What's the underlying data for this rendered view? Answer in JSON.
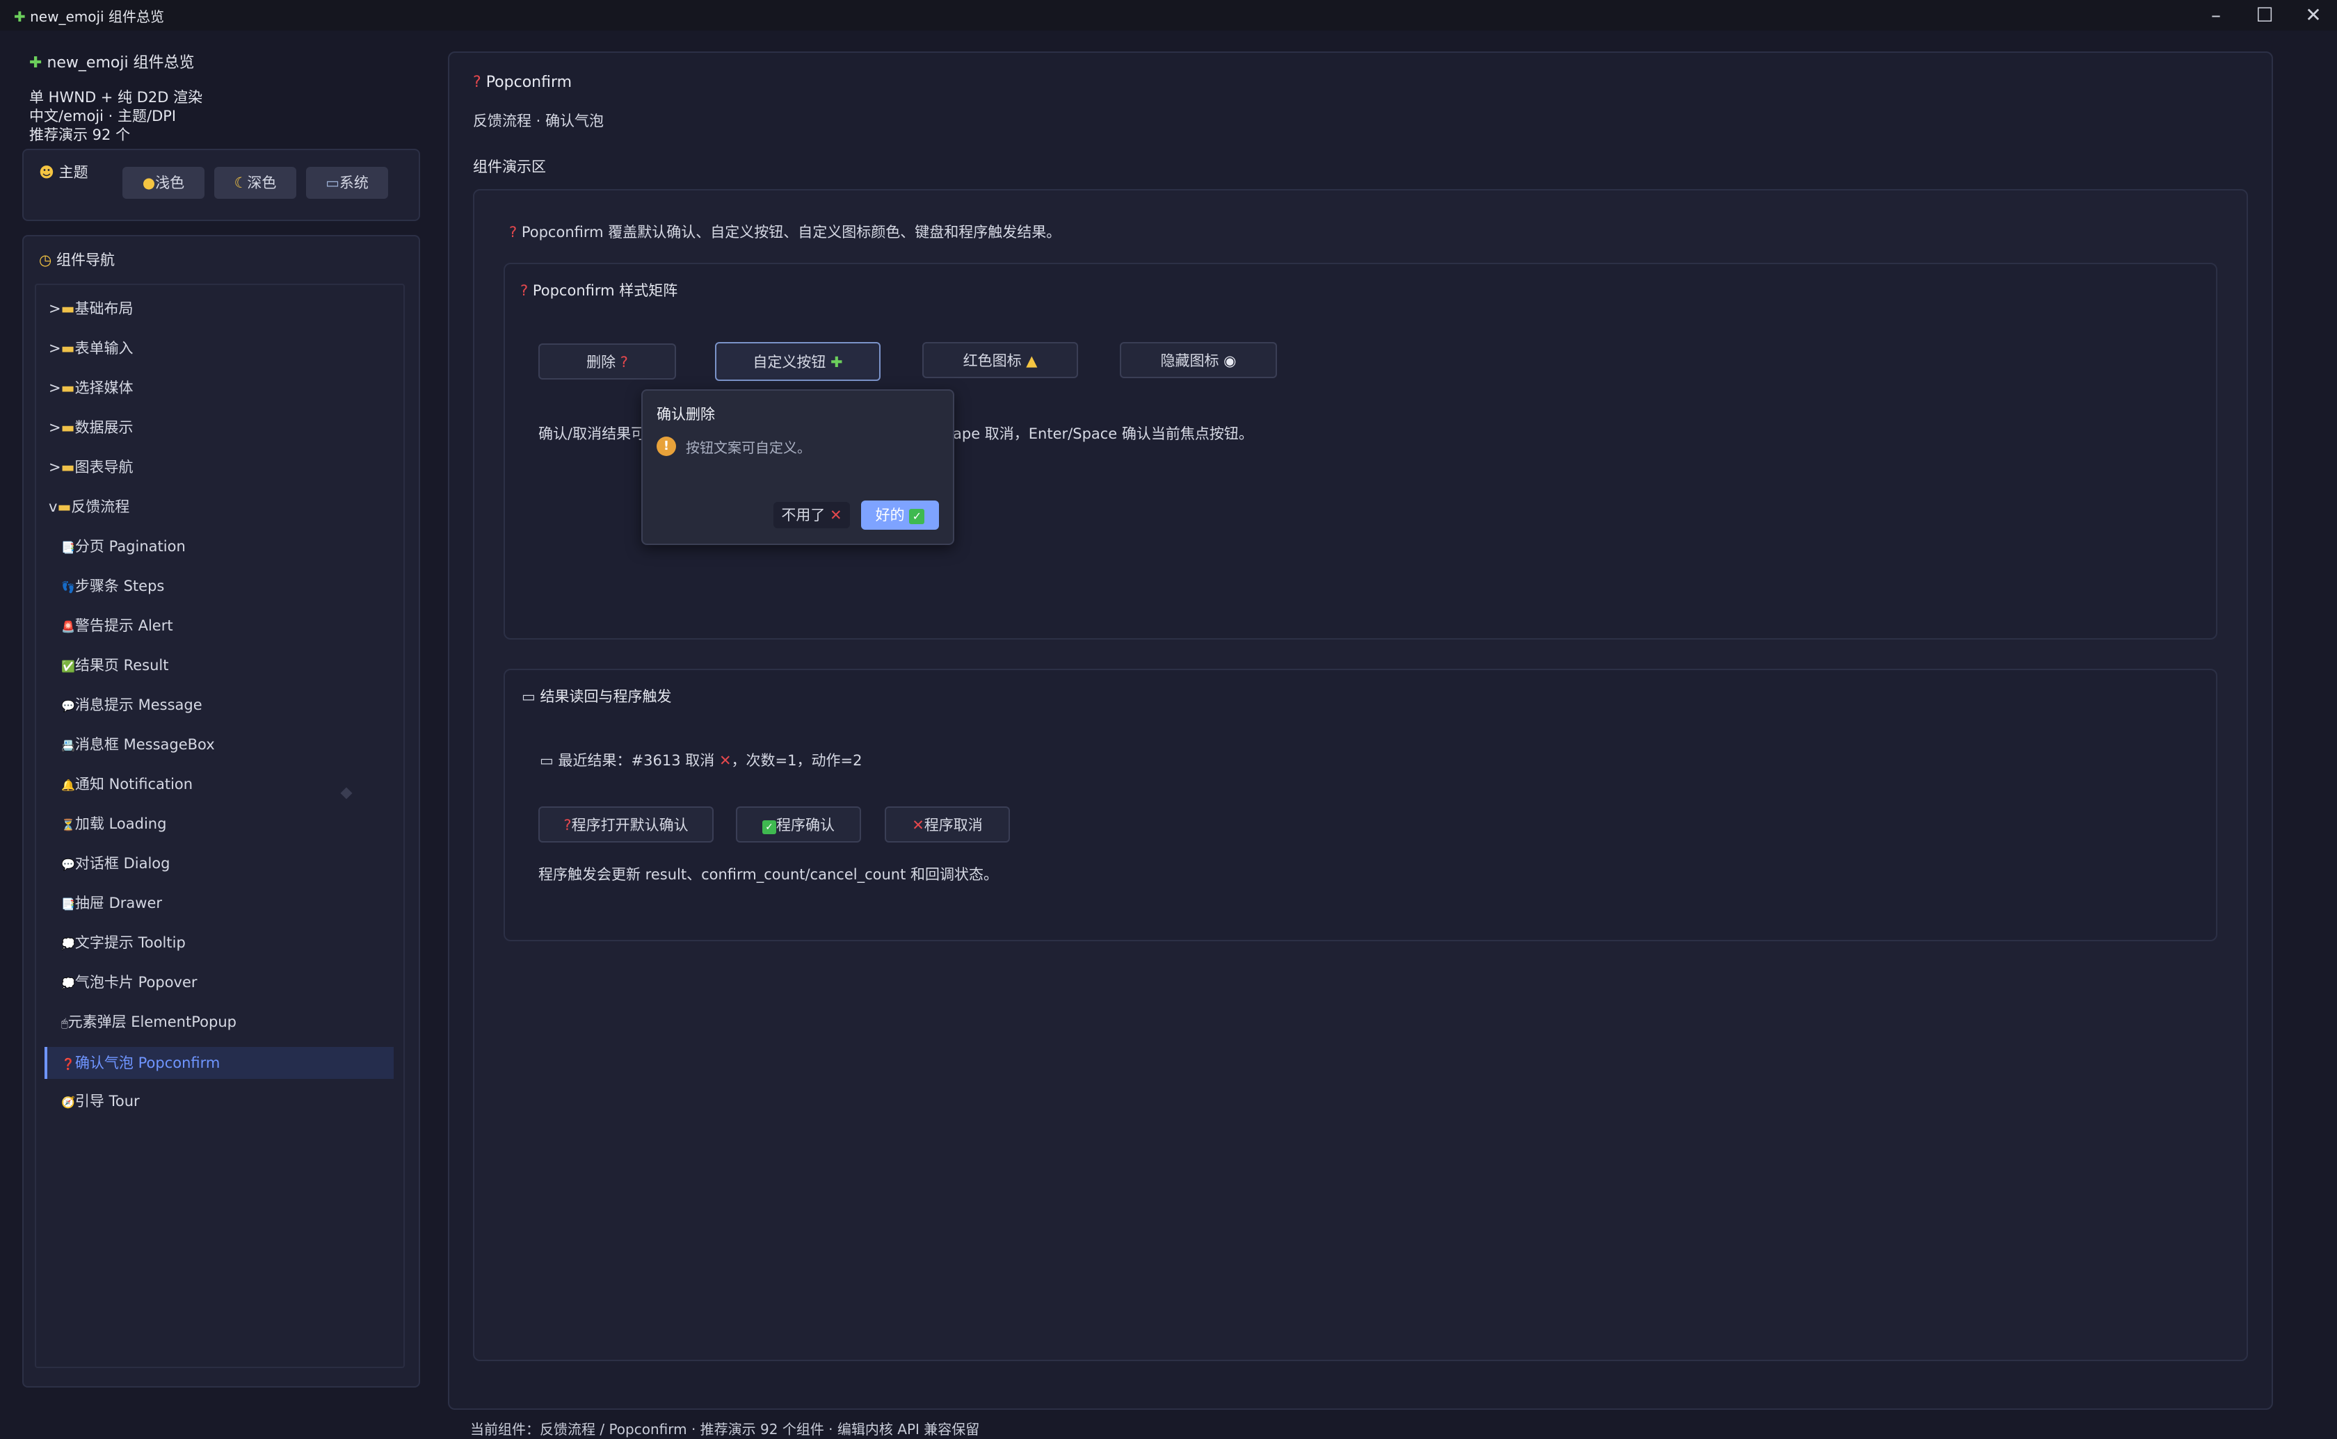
{
  "window": {
    "title": "new_emoji 组件总览",
    "title_icon": "puzzle-icon",
    "controls": [
      "minimize",
      "maximize",
      "close"
    ]
  },
  "sidebar": {
    "app_title": "new_emoji 组件总览",
    "info_lines": [
      "单 HWND + 纯 D2D 渲染",
      "中文/emoji · 主题/DPI",
      "推荐演示 92 个"
    ],
    "theme": {
      "label": "主题",
      "buttons": [
        {
          "label": "浅色",
          "icon": "sun-icon"
        },
        {
          "label": "深色",
          "icon": "moon-icon"
        },
        {
          "label": "系统",
          "icon": "laptop-icon"
        }
      ]
    },
    "nav": {
      "label": "组件导航",
      "groups": [
        {
          "label": "基础布局",
          "expanded": false
        },
        {
          "label": "表单输入",
          "expanded": false
        },
        {
          "label": "选择媒体",
          "expanded": false
        },
        {
          "label": "数据展示",
          "expanded": false
        },
        {
          "label": "图表导航",
          "expanded": false
        },
        {
          "label": "反馈流程",
          "expanded": true
        }
      ],
      "collapsed_marker": ">",
      "expanded_marker": "v",
      "items": [
        {
          "icon": "📑",
          "label": "分页 Pagination"
        },
        {
          "icon": "👣",
          "label": "步骤条 Steps"
        },
        {
          "icon": "🚨",
          "label": "警告提示 Alert"
        },
        {
          "icon": "✅",
          "label": "结果页 Result"
        },
        {
          "icon": "💬",
          "label": "消息提示 Message"
        },
        {
          "icon": "📇",
          "label": "消息框 MessageBox"
        },
        {
          "icon": "🔔",
          "label": "通知 Notification"
        },
        {
          "icon": "⏳",
          "label": "加载 Loading"
        },
        {
          "icon": "💬",
          "label": "对话框 Dialog"
        },
        {
          "icon": "📑",
          "label": "抽屉 Drawer"
        },
        {
          "icon": "💭",
          "label": "文字提示 Tooltip"
        },
        {
          "icon": "💭",
          "label": "气泡卡片 Popover"
        },
        {
          "icon": "🖱",
          "label": "元素弹层 ElementPopup"
        },
        {
          "icon": "❓",
          "label": "确认气泡 Popconfirm",
          "selected": true
        },
        {
          "icon": "🧭",
          "label": "引导 Tour"
        }
      ]
    }
  },
  "main": {
    "title": "Popconfirm",
    "subtitle": "反馈流程 · 确认气泡",
    "demo_area_label": "组件演示区",
    "description": "Popconfirm 覆盖默认确认、自定义按钮、自定义图标颜色、键盘和程序触发结果。",
    "style_matrix": {
      "title": "Popconfirm 样式矩阵",
      "buttons": [
        {
          "label": "删除",
          "icon": "❓"
        },
        {
          "label": "自定义按钮",
          "icon": "🧩"
        },
        {
          "label": "红色图标",
          "icon": "⚠️"
        },
        {
          "label": "隐藏图标",
          "icon": "👁️"
        }
      ],
      "note_left": "确认/取消结果可",
      "note_right": "ape 取消，Enter/Space 确认当前焦点按钮。"
    },
    "popconfirm": {
      "title": "确认删除",
      "message": "按钮文案可自定义。",
      "cancel_label": "不用了",
      "cancel_icon": "❌",
      "ok_label": "好的",
      "ok_icon": "✅"
    },
    "result_section": {
      "title": "结果读回与程序触发",
      "last_result_prefix": "最近结果：#3613 取消",
      "last_result_icon": "❌",
      "last_result_suffix": "，次数=1，动作=2",
      "buttons": [
        {
          "label": "程序打开默认确认",
          "icon": "❓"
        },
        {
          "label": "程序确认",
          "icon": "✅"
        },
        {
          "label": "程序取消",
          "icon": "❌"
        }
      ],
      "note": "程序触发会更新 result、confirm_count/cancel_count 和回调状态。"
    },
    "status_bar": "当前组件：反馈流程 / Popconfirm · 推荐演示 92 个组件 · 编辑内核 API 兼容保留"
  },
  "colors": {
    "background": "#181928",
    "panel": "#1f2133",
    "accent": "#6f95ff",
    "primary_button": "#7ea3ff",
    "warning": "#e8a23a"
  }
}
